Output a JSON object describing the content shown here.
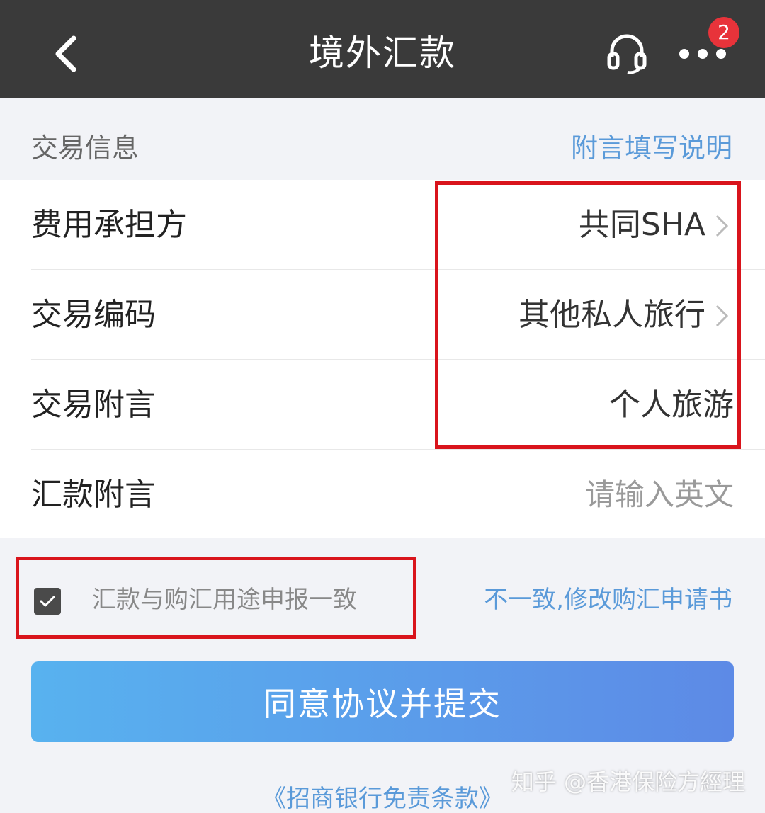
{
  "header": {
    "title": "境外汇款",
    "badge_count": "2",
    "icons": {
      "back": "chevron-left-icon",
      "support": "headset-icon",
      "more": "more-dots-icon"
    }
  },
  "section": {
    "title": "交易信息",
    "link": "附言填写说明"
  },
  "form": {
    "rows": [
      {
        "label": "费用承担方",
        "value": "共同SHA"
      },
      {
        "label": "交易编码",
        "value": "其他私人旅行"
      },
      {
        "label": "交易附言",
        "value": "个人旅游"
      },
      {
        "label": "汇款附言",
        "placeholder": "请输入英文"
      }
    ]
  },
  "declaration": {
    "checked": true,
    "label": "汇款与购汇用途申报一致",
    "mismatch_link": "不一致,修改购汇申请书"
  },
  "submit": {
    "label": "同意协议并提交"
  },
  "disclaimer": "《招商银行免责条款》",
  "watermark": "知乎 @香港保险方經理",
  "colors": {
    "header_bg": "#3a3a3a",
    "link": "#5a9ad9",
    "highlight": "#d9141c",
    "badge": "#e8333a",
    "button_start": "#58b2ef",
    "button_end": "#5d8ae6"
  }
}
